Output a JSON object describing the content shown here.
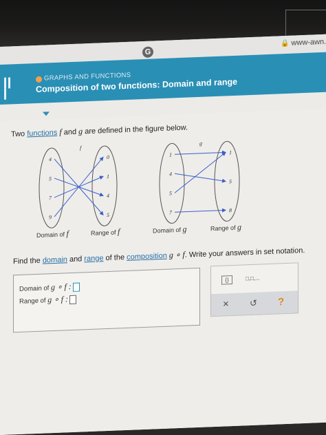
{
  "browser": {
    "url": "www-awn.a"
  },
  "header": {
    "topic": "GRAPHS AND FUNCTIONS",
    "title": "Composition of two functions: Domain and range",
    "accent_color": "#2a8fb5",
    "dot_color": "#f3a04b"
  },
  "question": {
    "pre": "Two ",
    "link": "functions",
    "mid": " and ",
    "post": " are defined in the figure below.",
    "f": "f",
    "g": "g"
  },
  "figure": {
    "f_label": "f",
    "g_label": "g",
    "f_domain": [
      "4",
      "5",
      "7",
      "9"
    ],
    "f_range": [
      "0",
      "1",
      "4",
      "5"
    ],
    "g_domain": [
      "1",
      "4",
      "5",
      "7"
    ],
    "g_range": [
      "1",
      "5",
      "8"
    ],
    "f_mapping": [
      [
        "4",
        "5"
      ],
      [
        "5",
        "4"
      ],
      [
        "7",
        "1"
      ],
      [
        "9",
        "0"
      ]
    ],
    "g_mapping": [
      [
        "1",
        "1"
      ],
      [
        "4",
        "5"
      ],
      [
        "5",
        "1"
      ],
      [
        "7",
        "8"
      ]
    ],
    "domain_f_label": "Domain of",
    "range_f_label": "Range of",
    "domain_g_label": "Domain of",
    "range_g_label": "Range of"
  },
  "task": {
    "pre": "Find the ",
    "domain": "domain",
    "and": " and ",
    "range": "range",
    "of_the": " of the ",
    "composition": "composition",
    "expr": "g ∘ f",
    "post": ". Write your answers in set notation."
  },
  "answers": {
    "domain_label": "Domain of",
    "range_label": "Range of",
    "expr": "g ∘ f :"
  },
  "tools": {
    "set_icon": "set-braces-icon",
    "list_icon": "ellipsis-list-icon",
    "list_text": "□,□,...",
    "clear": "×",
    "undo": "↺",
    "help": "?"
  }
}
